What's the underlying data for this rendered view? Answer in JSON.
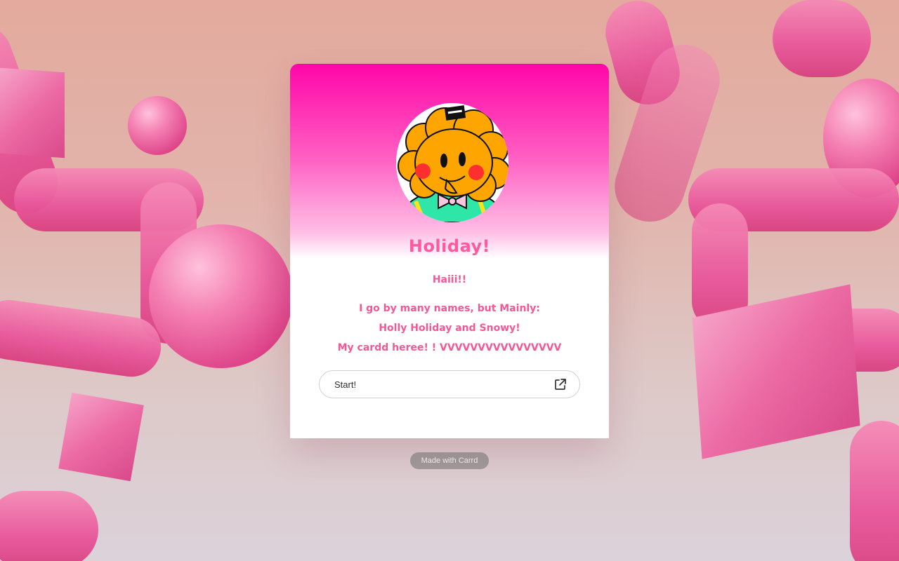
{
  "profile": {
    "name": "Holiday!",
    "greeting": "Haiii!!",
    "line1": "I go by many names, but Mainly:",
    "line2": "Holly Holiday and Snowy!",
    "line3": "My cardd heree! ! VVVVVVVVVVVVVVVV"
  },
  "button": {
    "label": "Start!",
    "icon": "external-link-icon"
  },
  "footer": {
    "made_with": "Made with Carrd"
  },
  "colors": {
    "accent": "#ff06a8",
    "text": "#f45796",
    "title": "#ff5aa0"
  }
}
